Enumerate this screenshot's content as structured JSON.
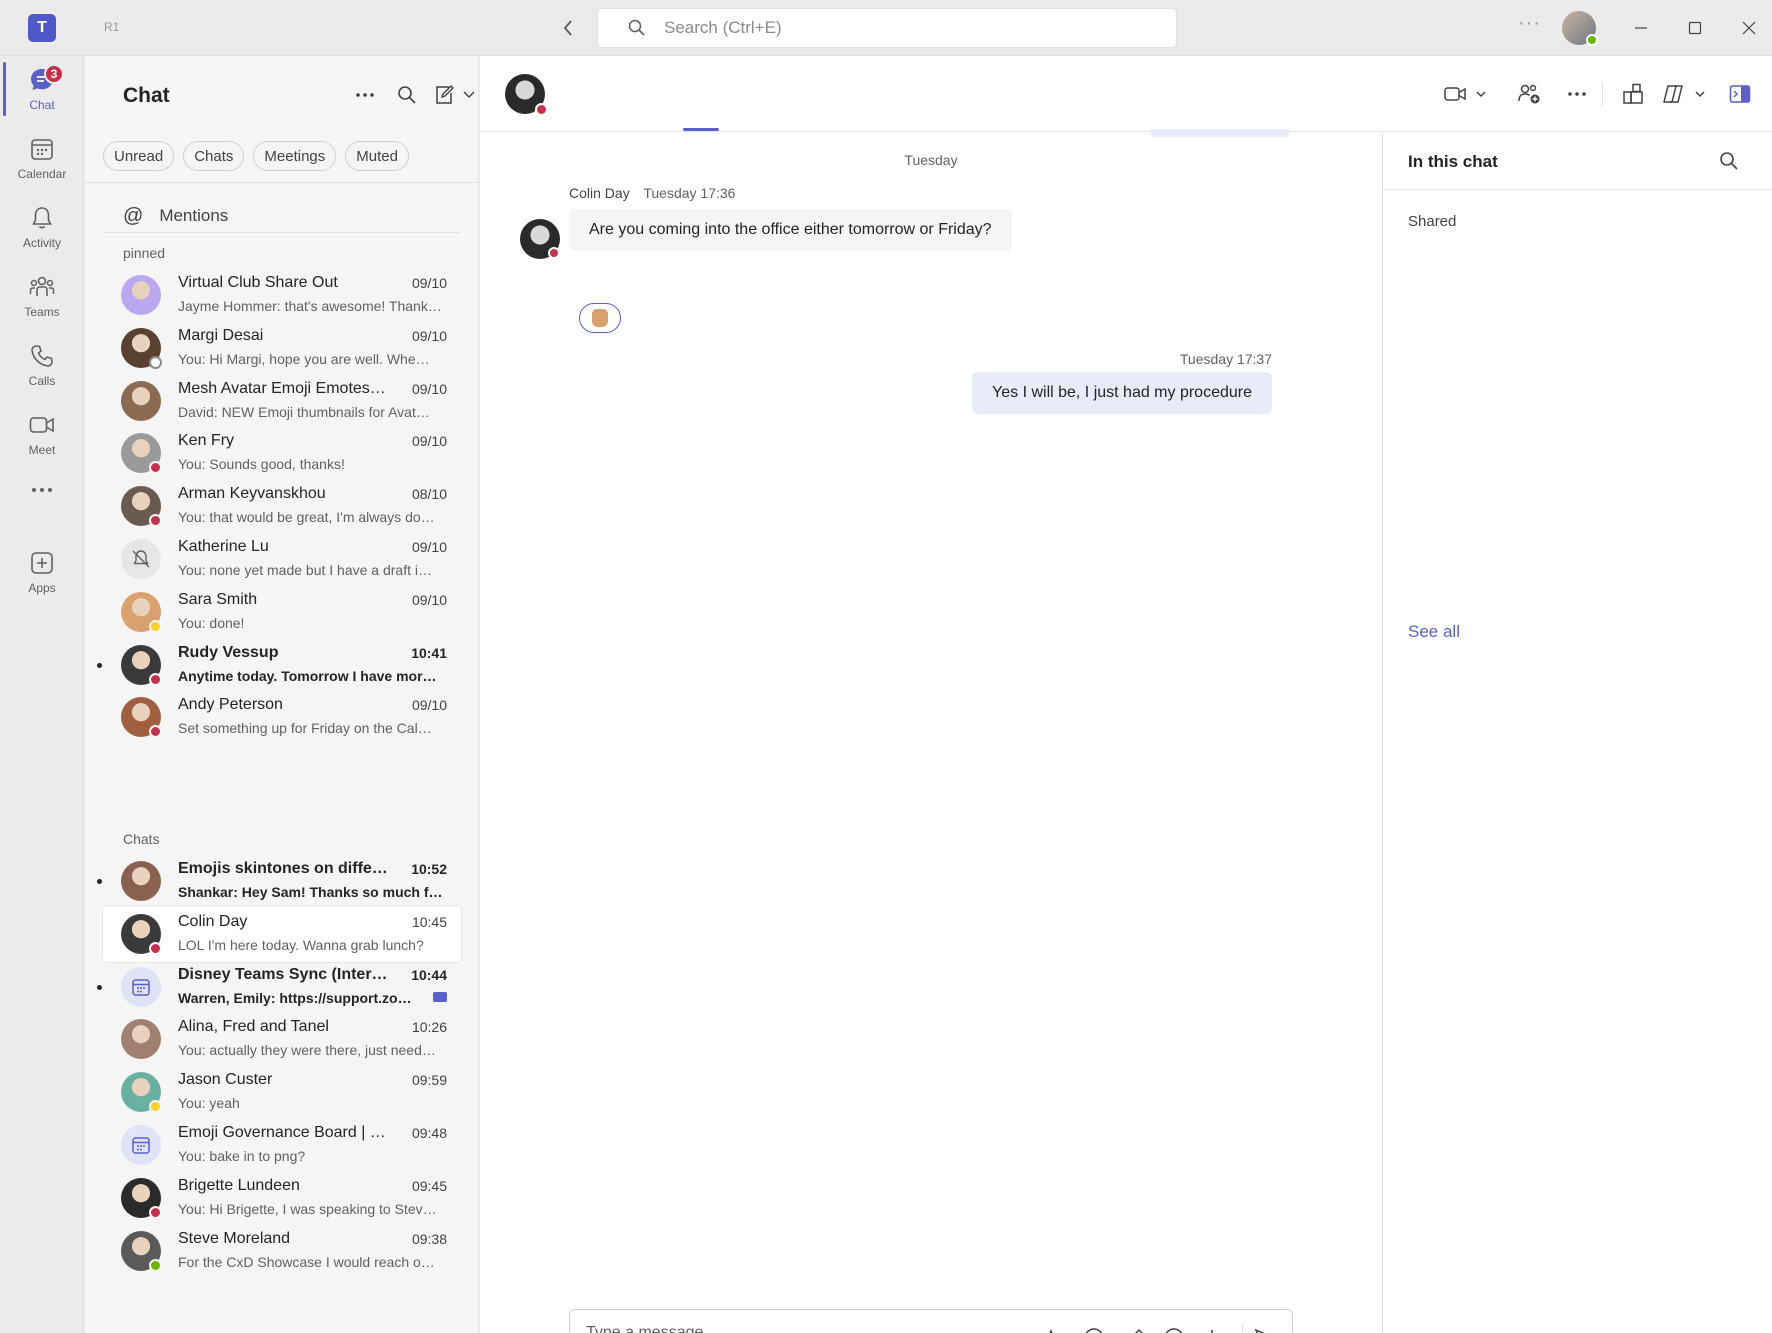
{
  "titlebar": {
    "ring_label": "R1",
    "search_placeholder": "Search (Ctrl+E)",
    "more": "···"
  },
  "rail": [
    {
      "label": "Chat",
      "icon": "chat-icon",
      "badge": "3",
      "active": true
    },
    {
      "label": "Calendar",
      "icon": "calendar-icon"
    },
    {
      "label": "Activity",
      "icon": "bell-icon"
    },
    {
      "label": "Teams",
      "icon": "teams-icon"
    },
    {
      "label": "Calls",
      "icon": "phone-icon"
    },
    {
      "label": "Meet",
      "icon": "video-icon"
    },
    {
      "label": "Apps",
      "icon": "add-apps-icon"
    }
  ],
  "chat_list": {
    "title": "Chat",
    "filters": [
      "Unread",
      "Chats",
      "Meetings",
      "Muted"
    ],
    "mentions_label": "Mentions",
    "pinned_label": "pinned",
    "chats_label": "Chats",
    "pinned": [
      {
        "name": "Virtual Club Share Out",
        "time": "09/10",
        "preview": "Jayme Hommer: that's awesome! Thanks…",
        "avatar_color": "#b9a7f0",
        "presence": "none"
      },
      {
        "name": "Margi Desai",
        "time": "09/10",
        "preview": "You: Hi Margi, hope you are well. Whe…",
        "avatar_color": "#5a4030",
        "presence": "offline"
      },
      {
        "name": "Mesh Avatar Emoji Emotes…",
        "time": "09/10",
        "preview": "David: NEW Emoji thumbnails for Avat…",
        "avatar_color": "#8a6a50",
        "presence": "none"
      },
      {
        "name": "Ken Fry",
        "time": "09/10",
        "preview": "You: Sounds good, thanks!",
        "avatar_color": "#9a9a9a",
        "presence": "red"
      },
      {
        "name": "Arman Keyvanskhou",
        "time": "08/10",
        "preview": "You: that would be great, I'm always do…",
        "avatar_color": "#6a5a50",
        "presence": "red"
      },
      {
        "name": "Katherine Lu",
        "time": "09/10",
        "preview": "You: none yet made but I have a draft i…",
        "avatar_color": "#e6e6e6",
        "presence": "none",
        "muted": true
      },
      {
        "name": "Sara Smith",
        "time": "09/10",
        "preview": "You: done!",
        "avatar_color": "#d9a070",
        "presence": "yellow"
      },
      {
        "name": "Rudy Vessup",
        "time": "10:41",
        "preview": "Anytime today. Tomorrow I have mor…",
        "avatar_color": "#3a3a3a",
        "presence": "red",
        "unread": true
      },
      {
        "name": "Andy Peterson",
        "time": "09/10",
        "preview": "Set something up for Friday on the Cal…",
        "avatar_color": "#a06040",
        "presence": "red"
      }
    ],
    "chats": [
      {
        "name": "Emojis skintones on diffe…",
        "time": "10:52",
        "preview": "Shankar: Hey Sam! Thanks so much f…",
        "avatar_color": "#8a6050",
        "presence": "none",
        "unread": true
      },
      {
        "name": "Colin Day",
        "time": "10:45",
        "preview": "LOL I'm here today. Wanna grab lunch?",
        "avatar_color": "#3a3a3a",
        "presence": "red",
        "selected": true
      },
      {
        "name": "Disney Teams Sync (Inter…",
        "time": "10:44",
        "preview": "Warren, Emily: https://support.zo…",
        "avatar_color": "#e0e2f8",
        "presence": "none",
        "unread": true,
        "calendar": true,
        "meeting": true
      },
      {
        "name": "Alina, Fred and Tanel",
        "time": "10:26",
        "preview": "You: actually they were there, just need…",
        "avatar_color": "#a08070",
        "presence": "none"
      },
      {
        "name": "Jason Custer",
        "time": "09:59",
        "preview": "You: yeah",
        "avatar_color": "#6ab0a0",
        "presence": "yellow"
      },
      {
        "name": "Emoji Governance Board | …",
        "time": "09:48",
        "preview": "You: bake in to png?",
        "avatar_color": "#e0e2f8",
        "presence": "none",
        "calendar": true
      },
      {
        "name": "Brigette Lundeen",
        "time": "09:45",
        "preview": "You: Hi Brigette, I was speaking to Stev…",
        "avatar_color": "#2a2a2a",
        "presence": "red"
      },
      {
        "name": "Steve Moreland",
        "time": "09:38",
        "preview": "For the CxD Showcase I would reach o…",
        "avatar_color": "#5a5a5a",
        "presence": "green"
      }
    ]
  },
  "conversation": {
    "date_separator": "Tuesday",
    "incoming": {
      "author": "Colin Day",
      "time": "Tuesday 17:36",
      "text": "Are you coming into the office either tomorrow or Friday?",
      "reaction": "thumbs-up"
    },
    "outgoing": {
      "time": "Tuesday 17:37",
      "text": "Yes I will be, I just had my procedure"
    },
    "compose_placeholder": "Type a message"
  },
  "side_panel": {
    "title": "In this chat",
    "shared_label": "Shared",
    "see_all": "See all"
  },
  "colors": {
    "accent": "#5b5fc7",
    "badge": "#c4314b",
    "busy": "#c4314b",
    "available": "#6bb700",
    "away": "#f8d22a"
  }
}
